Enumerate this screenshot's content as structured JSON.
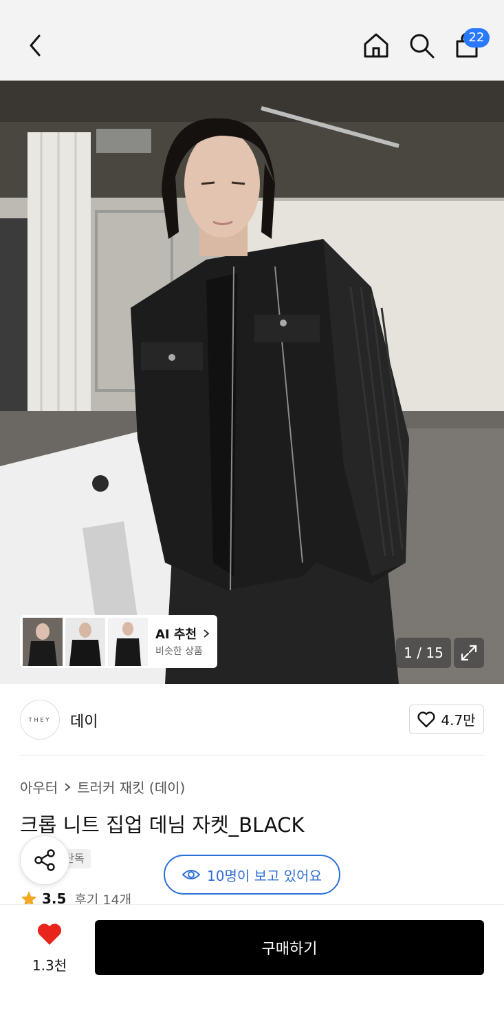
{
  "header": {
    "back_icon": "chevron-left-icon",
    "home_icon": "home-icon",
    "search_icon": "search-icon",
    "cart_icon": "shopping-bag-icon",
    "cart_badge": "22",
    "badge_color": "#2979ff"
  },
  "gallery": {
    "counter": "1 / 15",
    "expand_icon": "expand-icon",
    "ai_recommend": {
      "title": "AI 추천",
      "subtitle": "비슷한 상품",
      "chevron_icon": "chevron-right-icon"
    }
  },
  "brand": {
    "logo_text": "THEY",
    "name": "데이",
    "like_count": "4.7만",
    "heart_icon": "heart-outline-icon"
  },
  "product": {
    "breadcrumb": [
      "아우터",
      "트러커 재킷 (데이)"
    ],
    "title": "크롭 니트 집업 데님 자켓_BLACK",
    "tag": "단독",
    "viewers": "10명이 보고 있어요",
    "accent_color": "#2f6fd6",
    "rating": "3.5",
    "reviews": "후기 14개"
  },
  "bottom": {
    "like_count": "1.3천",
    "buy_label": "구매하기"
  }
}
